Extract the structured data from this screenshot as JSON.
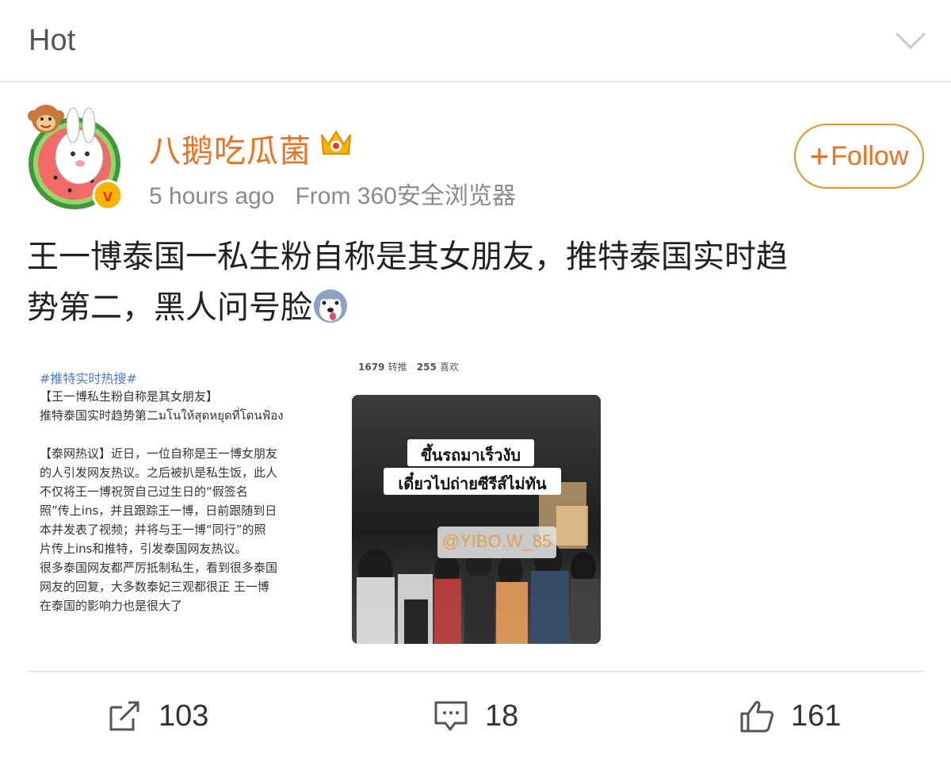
{
  "header": {
    "title": "Hot"
  },
  "post": {
    "username": "八鹅吃瓜菌",
    "timestamp": "5 hours ago",
    "source": "From 360安全浏览器",
    "follow_label": "Follow",
    "text_line1": "王一博泰国一私生粉自称是其女朋友，推特泰国实时趋",
    "text_line2": "势第二，黑人问号脸"
  },
  "image_left": {
    "hashtag": "#推特实时热搜#",
    "lines": [
      "【王一博私生粉自称是其女朋友】",
      "推特泰国实时趋势第二มโนให้สุดหยุดที่โดนฟ้อง",
      "【泰网热议】近日，一位自称是王一博女朋友",
      "的人引发网友热议。之后被扒是私生饭，此人",
      "不仅将王一博祝贺自己过生日的“假签名",
      "照”传上ins，并且跟踪王一博，日前跟随到日",
      "本并发表了视频；并将与王一博“同行”的照",
      "片传上ins和推特，引发泰国网友热议。",
      "很多泰国网友都严厉抵制私生，看到很多泰国",
      "网友的回复，大多数泰妃三观都很正 王一博",
      "在泰国的影响力也是很大了"
    ]
  },
  "image_right": {
    "retweets": "1679",
    "retweets_label": "转推",
    "likes": "255",
    "likes_label": "喜欢",
    "caption_line1": "ขึ้นรถมาเร็วงับ",
    "caption_line2": "เดี๋ยวไปถ่ายซีรีส์ไม่ทัน",
    "handle": "@YIBO.W_85"
  },
  "actions": {
    "repost_count": "103",
    "comment_count": "18",
    "like_count": "161"
  },
  "colors": {
    "accent": "#f0701e",
    "follow_border": "#f0901e",
    "meta": "#8a8a8a"
  }
}
